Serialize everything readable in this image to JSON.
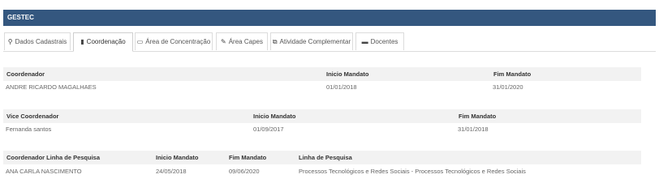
{
  "header": {
    "title": "GESTEC"
  },
  "tabs": [
    {
      "icon": "map-marker-icon",
      "glyph": "⚲",
      "label": "Dados Cadastrais",
      "active": false
    },
    {
      "icon": "book-icon",
      "glyph": "▮",
      "label": "Coordenação",
      "active": true
    },
    {
      "icon": "folder-icon",
      "glyph": "▭",
      "label": "Área de Concentração",
      "active": false
    },
    {
      "icon": "edit-icon",
      "glyph": "✎",
      "label": "Área Capes",
      "active": false
    },
    {
      "icon": "clone-icon",
      "glyph": "⧉",
      "label": "Atividade Complementar",
      "active": false
    },
    {
      "icon": "briefcase-icon",
      "glyph": "▬",
      "label": "Docentes",
      "active": false
    }
  ],
  "coordenador": {
    "headers": [
      "Coordenador",
      "Inicio Mandato",
      "Fim Mandato"
    ],
    "row": [
      "ANDRE RICARDO MAGALHAES",
      "01/01/2018",
      "31/01/2020"
    ]
  },
  "vice": {
    "headers": [
      "Vice Coordenador",
      "Inicio Mandato",
      "Fim Mandato"
    ],
    "row": [
      "Fernanda santos",
      "01/09/2017",
      "31/01/2018"
    ]
  },
  "linha": {
    "headers": [
      "Coordenador Linha de Pesquisa",
      "Inicio Mandato",
      "Fim Mandato",
      "Linha de Pesquisa"
    ],
    "row": [
      "ANA CARLA NASCIMENTO",
      "24/05/2018",
      "09/06/2020",
      "Processos Tecnológicos e Redes Sociais - Processos Tecnológicos e Redes Sociais"
    ]
  }
}
